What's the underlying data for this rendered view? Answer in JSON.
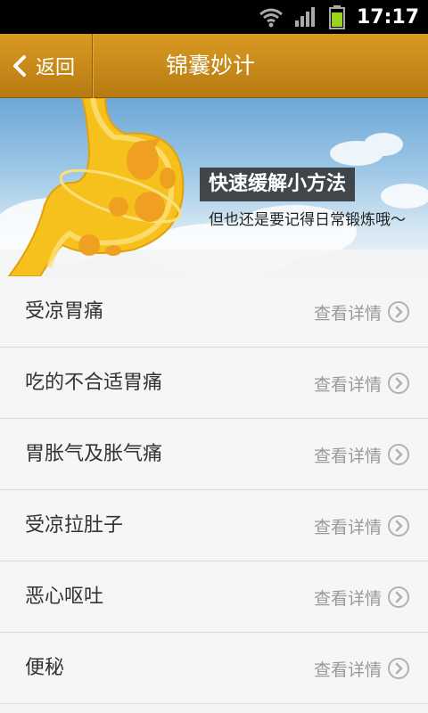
{
  "status_bar": {
    "time": "17:17",
    "icons": [
      "wifi-icon",
      "signal-icon",
      "battery-icon"
    ]
  },
  "header": {
    "back_label": "返回",
    "title": "锦囊妙计"
  },
  "banner": {
    "title": "快速缓解小方法",
    "subtitle": "但也还是要记得日常锻炼哦～"
  },
  "list": {
    "items": [
      {
        "label": "受凉胃痛",
        "detail": "查看详情"
      },
      {
        "label": "吃的不合适胃痛",
        "detail": "查看详情"
      },
      {
        "label": "胃胀气及胀气痛",
        "detail": "查看详情"
      },
      {
        "label": "受凉拉肚子",
        "detail": "查看详情"
      },
      {
        "label": "恶心呕吐",
        "detail": "查看详情"
      },
      {
        "label": "便秘",
        "detail": "查看详情"
      }
    ]
  },
  "colors": {
    "header": "#c88812",
    "banner_sky": "#8fbfe2",
    "stomach": "#f6c11d",
    "divider": "#dcdcdc"
  }
}
